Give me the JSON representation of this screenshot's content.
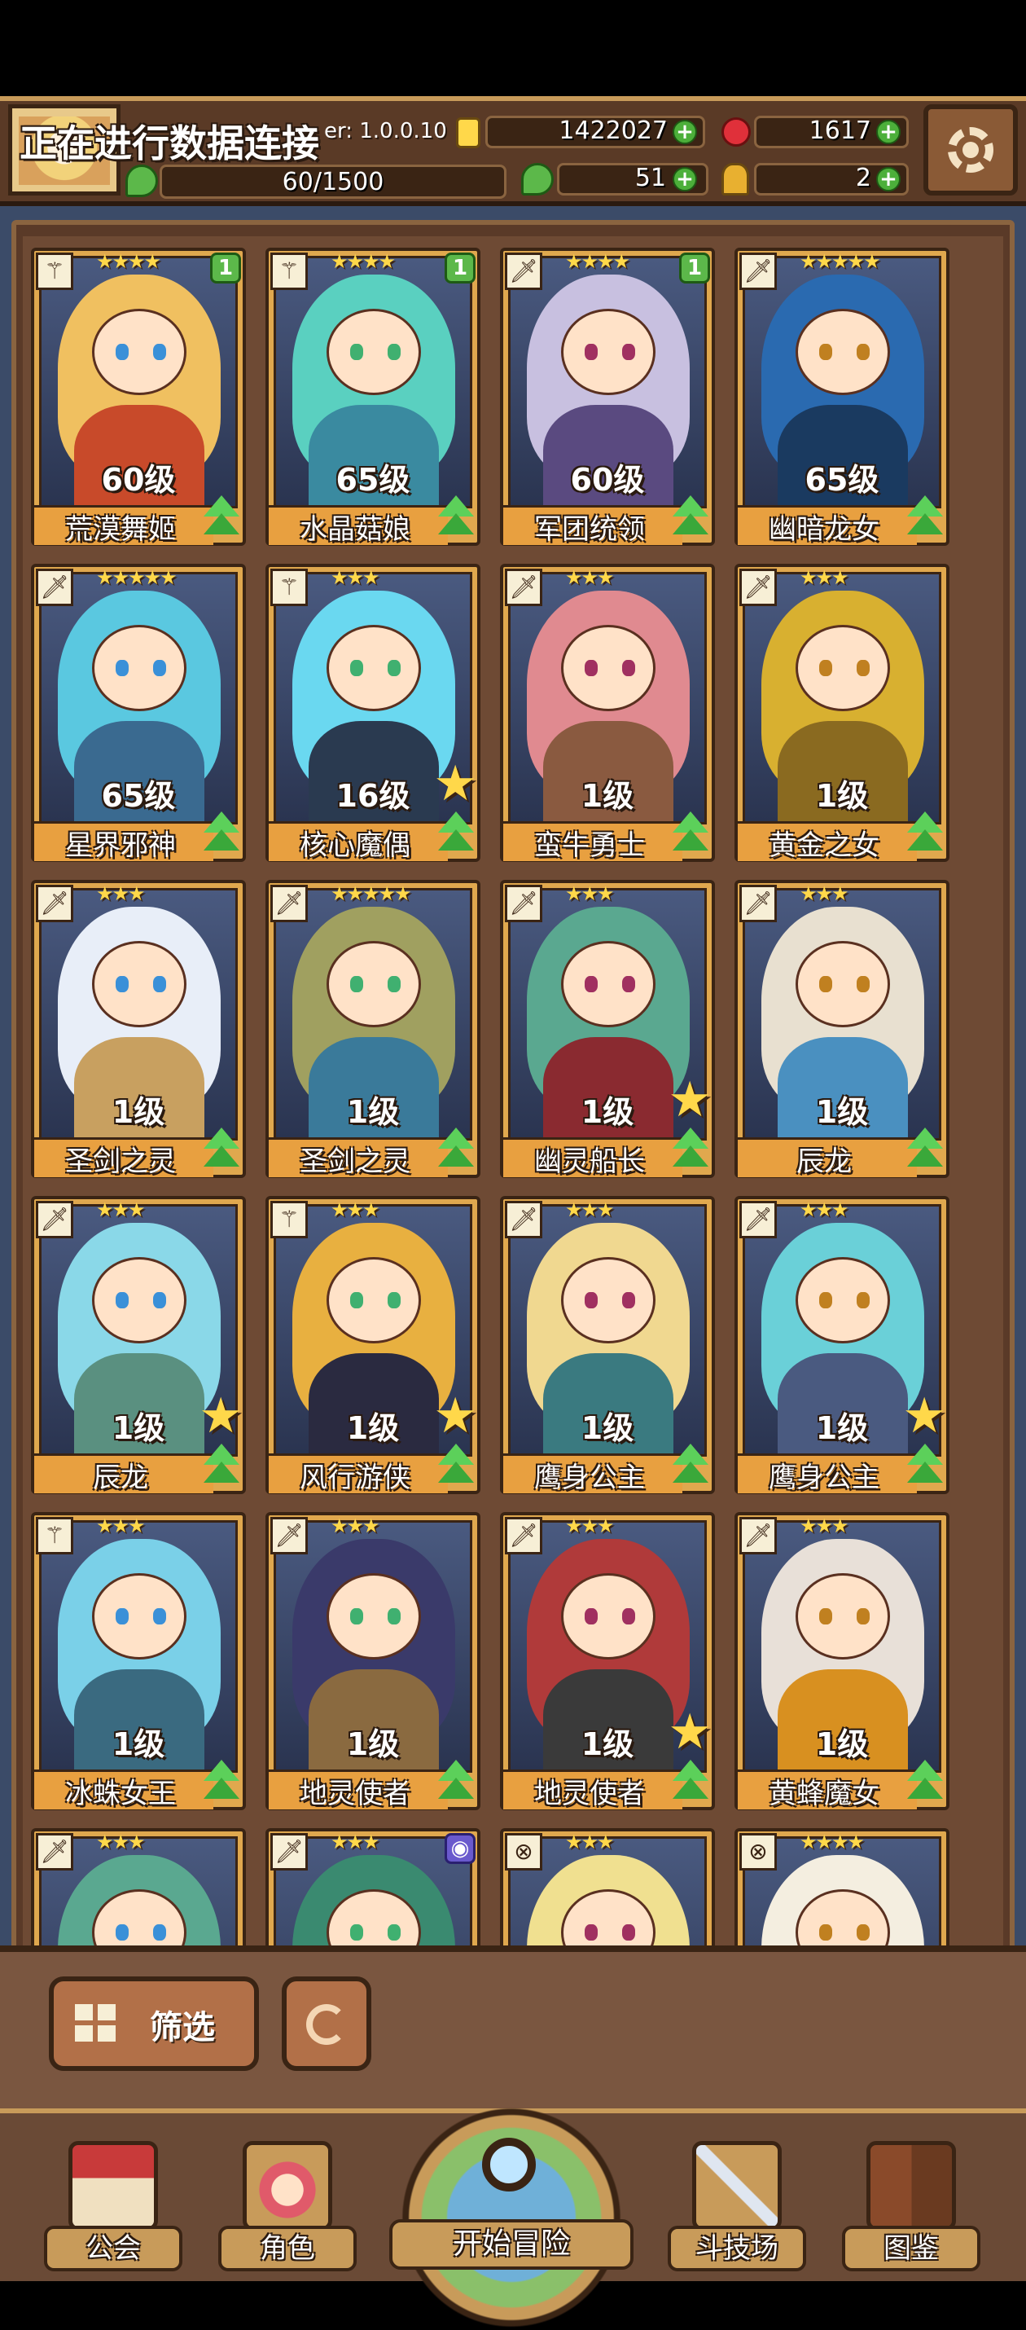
{
  "header": {
    "status_text": "正在进行数据连接",
    "version": "er: 1.0.0.10",
    "resources": [
      {
        "id": "gold",
        "icon": "gold-coin-icon",
        "value": "1422027"
      },
      {
        "id": "gem",
        "icon": "red-gem-icon",
        "value": "1617"
      },
      {
        "id": "stamina",
        "icon": "clover-icon",
        "value": "60/1500"
      },
      {
        "id": "clover",
        "icon": "clover-icon",
        "value": "51"
      },
      {
        "id": "key",
        "icon": "gold-key-icon",
        "value": "2"
      }
    ]
  },
  "characters": [
    {
      "name": "荒漠舞姬",
      "level": "60级",
      "stars": "★★★★",
      "class": "staff",
      "badge": "1",
      "gold_star": false,
      "hair": "#f0c060",
      "body": "#c84a2a"
    },
    {
      "name": "水晶菇娘",
      "level": "65级",
      "stars": "★★★★",
      "class": "staff",
      "badge": "1",
      "gold_star": false,
      "hair": "#5ad0c0",
      "body": "#3a8aa0"
    },
    {
      "name": "军团统领",
      "level": "60级",
      "stars": "★★★★",
      "class": "sword",
      "badge": "1",
      "gold_star": false,
      "hair": "#c8c0e0",
      "body": "#5a4a80"
    },
    {
      "name": "幽暗龙女",
      "level": "65级",
      "stars": "★★★★★",
      "class": "sword",
      "badge": "",
      "gold_star": false,
      "hair": "#2a6ab0",
      "body": "#1a3a60"
    },
    {
      "name": "星界邪神",
      "level": "65级",
      "stars": "★★★★★",
      "class": "sword",
      "badge": "",
      "gold_star": false,
      "hair": "#5ac8e0",
      "body": "#3a6a90"
    },
    {
      "name": "核心魔偶",
      "level": "16级",
      "stars": "★★★",
      "class": "staff",
      "badge": "",
      "gold_star": true,
      "hair": "#6ad8f0",
      "body": "#2a3a50"
    },
    {
      "name": "蛮牛勇士",
      "level": "1级",
      "stars": "★★★",
      "class": "sword",
      "badge": "",
      "gold_star": false,
      "hair": "#e08a90",
      "body": "#8a5a40"
    },
    {
      "name": "黄金之女",
      "level": "1级",
      "stars": "★★★",
      "class": "sword",
      "badge": "",
      "gold_star": false,
      "hair": "#d8b030",
      "body": "#8a6a20"
    },
    {
      "name": "圣剑之灵",
      "level": "1级",
      "stars": "★★★",
      "class": "sword",
      "badge": "",
      "gold_star": false,
      "hair": "#e8eef8",
      "body": "#c8a060"
    },
    {
      "name": "圣剑之灵",
      "level": "1级",
      "stars": "★★★★★",
      "class": "sword",
      "badge": "",
      "gold_star": false,
      "hair": "#a0a060",
      "body": "#3a7a9a"
    },
    {
      "name": "幽灵船长",
      "level": "1级",
      "stars": "★★★",
      "class": "sword",
      "badge": "",
      "gold_star": true,
      "hair": "#5aa890",
      "body": "#8a2a30"
    },
    {
      "name": "辰龙",
      "level": "1级",
      "stars": "★★★",
      "class": "sword",
      "badge": "",
      "gold_star": false,
      "hair": "#e8e0d0",
      "body": "#4a90c0"
    },
    {
      "name": "辰龙",
      "level": "1级",
      "stars": "★★★",
      "class": "sword",
      "badge": "",
      "gold_star": true,
      "hair": "#8ad8e8",
      "body": "#5a9080"
    },
    {
      "name": "风行游侠",
      "level": "1级",
      "stars": "★★★",
      "class": "staff",
      "badge": "",
      "gold_star": true,
      "hair": "#e8b040",
      "body": "#2a2a40"
    },
    {
      "name": "鹰身公主",
      "level": "1级",
      "stars": "★★★",
      "class": "sword",
      "badge": "",
      "gold_star": false,
      "hair": "#f0d890",
      "body": "#3a7a80"
    },
    {
      "name": "鹰身公主",
      "level": "1级",
      "stars": "★★★",
      "class": "sword",
      "badge": "",
      "gold_star": true,
      "hair": "#6ad0d8",
      "body": "#4a5a80"
    },
    {
      "name": "冰蛛女王",
      "level": "1级",
      "stars": "★★★",
      "class": "staff",
      "badge": "",
      "gold_star": false,
      "hair": "#7ad0e8",
      "body": "#3a6a80"
    },
    {
      "name": "地灵使者",
      "level": "1级",
      "stars": "★★★",
      "class": "sword",
      "badge": "",
      "gold_star": false,
      "hair": "#3a3a6a",
      "body": "#8a6a40"
    },
    {
      "name": "地灵使者",
      "level": "1级",
      "stars": "★★★",
      "class": "sword",
      "badge": "",
      "gold_star": true,
      "hair": "#b03a3a",
      "body": "#3a3a3a"
    },
    {
      "name": "黄蜂魔女",
      "level": "1级",
      "stars": "★★★",
      "class": "sword",
      "badge": "",
      "gold_star": false,
      "hair": "#e8e0d8",
      "body": "#d89020"
    },
    {
      "name": "",
      "level": "",
      "stars": "★★★",
      "class": "sword",
      "badge": "",
      "gold_star": false,
      "hair": "#5aa890",
      "body": "#3a6a80"
    },
    {
      "name": "",
      "level": "",
      "stars": "★★★",
      "class": "sword",
      "badge": "purple",
      "gold_star": false,
      "hair": "#3a8a70",
      "body": "#2a4a50"
    },
    {
      "name": "",
      "level": "",
      "stars": "★★★",
      "class": "shield",
      "badge": "",
      "gold_star": false,
      "hair": "#f0e090",
      "body": "#c8d8e8"
    },
    {
      "name": "",
      "level": "",
      "stars": "★★★★",
      "class": "shield",
      "badge": "",
      "gold_star": false,
      "hair": "#f4eee0",
      "body": "#a8d0e0"
    }
  ],
  "controls": {
    "filter_label": "筛选",
    "filter_icon": "grid-icon",
    "refresh_icon": "refresh-icon"
  },
  "nav": [
    {
      "id": "guild",
      "label": "公会",
      "icon": "guild-house-icon"
    },
    {
      "id": "characters",
      "label": "角色",
      "icon": "character-icon"
    },
    {
      "id": "adventure",
      "label": "开始冒险",
      "icon": "magnifier-globe-icon"
    },
    {
      "id": "arena",
      "label": "斗技场",
      "icon": "crossed-swords-icon"
    },
    {
      "id": "codex",
      "label": "图鉴",
      "icon": "book-icon"
    }
  ],
  "colors": {
    "accent": "#e0a84e",
    "panel": "#5a3a28",
    "bg": "#3b4b68",
    "upgrade_green": "#5cd05a",
    "star_gold": "#ffd84a"
  }
}
